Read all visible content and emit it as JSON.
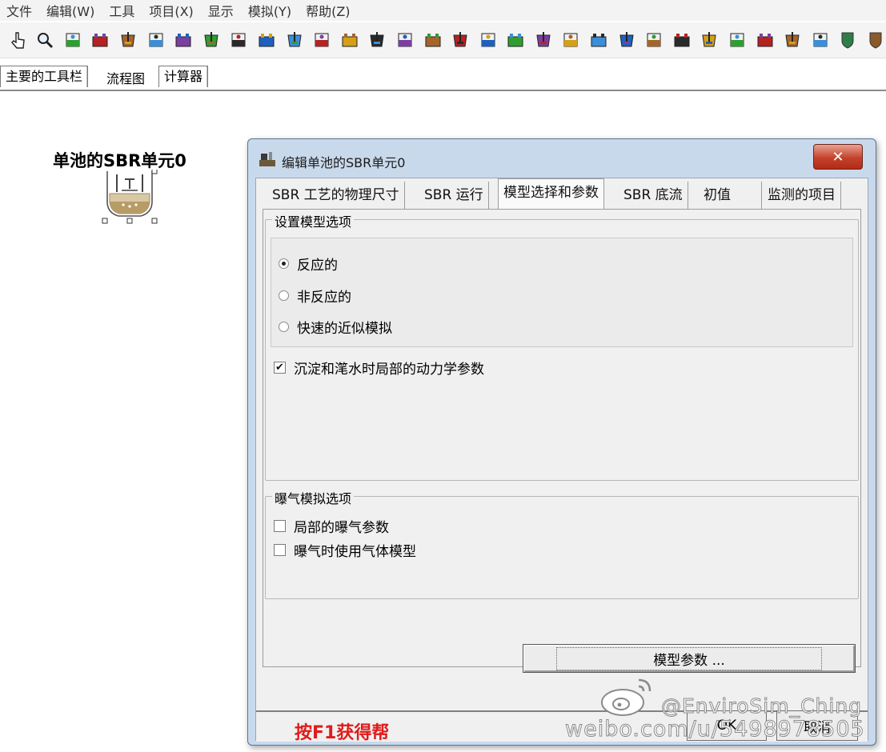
{
  "menu": [
    "文件",
    "编辑(W)",
    "工具",
    "项目(X)",
    "显示",
    "模拟(Y)",
    "帮助(Z)"
  ],
  "toolbar_icons": [
    "pointer-hand-icon",
    "zoom-icon",
    "split-icon",
    "combine-icon",
    "separator-icon",
    "tank-icon",
    "pump-icon",
    "influent-icon",
    "effluent-icon",
    "cstr-icon",
    "plug-flow-icon",
    "bioreactor-icon",
    "oxidation-ditch-icon",
    "aerated-tank-icon",
    "membrane-bioreactor-icon",
    "sbr-icon",
    "digester-icon",
    "primary-clarifier-icon",
    "tower-icon",
    "filter-icon",
    "storage-icon",
    "clarifier-icon",
    "settler-icon",
    "sbr-basin-icon",
    "aerobic-sbr-icon",
    "dual-sbr-icon",
    "multi-sbr-icon",
    "sbr-aeration-icon",
    "gas-icon",
    "book-icon",
    "shield-green-icon",
    "shield-brown-icon"
  ],
  "app_tabs": [
    "主要的工具栏",
    "流程图",
    "计算器"
  ],
  "unit": {
    "label": "单池的SBR单元0"
  },
  "dialog": {
    "title": "编辑单池的SBR单元0",
    "close_label": "✕",
    "tabs": [
      "SBR 工艺的物理尺寸",
      "SBR 运行",
      "模型选择和参数",
      "SBR 底流",
      "初值",
      "监测的项目"
    ],
    "active_tab": 2,
    "model_group": {
      "title": "设置模型选项",
      "radios": [
        {
          "label": "反应的",
          "selected": true
        },
        {
          "label": "非反应的",
          "selected": false
        },
        {
          "label": "快速的近似模拟",
          "selected": false
        }
      ],
      "checkbox": {
        "label": "沉淀和滗水时局部的动力学参数",
        "checked": true,
        "mark": "✔"
      }
    },
    "aeration_group": {
      "title": "曝气模拟选项",
      "checkboxes": [
        {
          "label": "局部的曝气参数",
          "checked": false
        },
        {
          "label": "曝气时使用气体模型",
          "checked": false
        }
      ]
    },
    "model_params_button": "模型参数 ...",
    "help_text": "按F1获得帮",
    "ok_label": "OK",
    "cancel_label": "取消"
  },
  "watermark": {
    "line1": "@EnviroSim_Ching",
    "line2": "weibo.com/u/5498978505"
  },
  "colors": {
    "dialog_frame": "#c9d9ec",
    "close_button": "#c3412a",
    "help_text": "#e01b1b"
  }
}
